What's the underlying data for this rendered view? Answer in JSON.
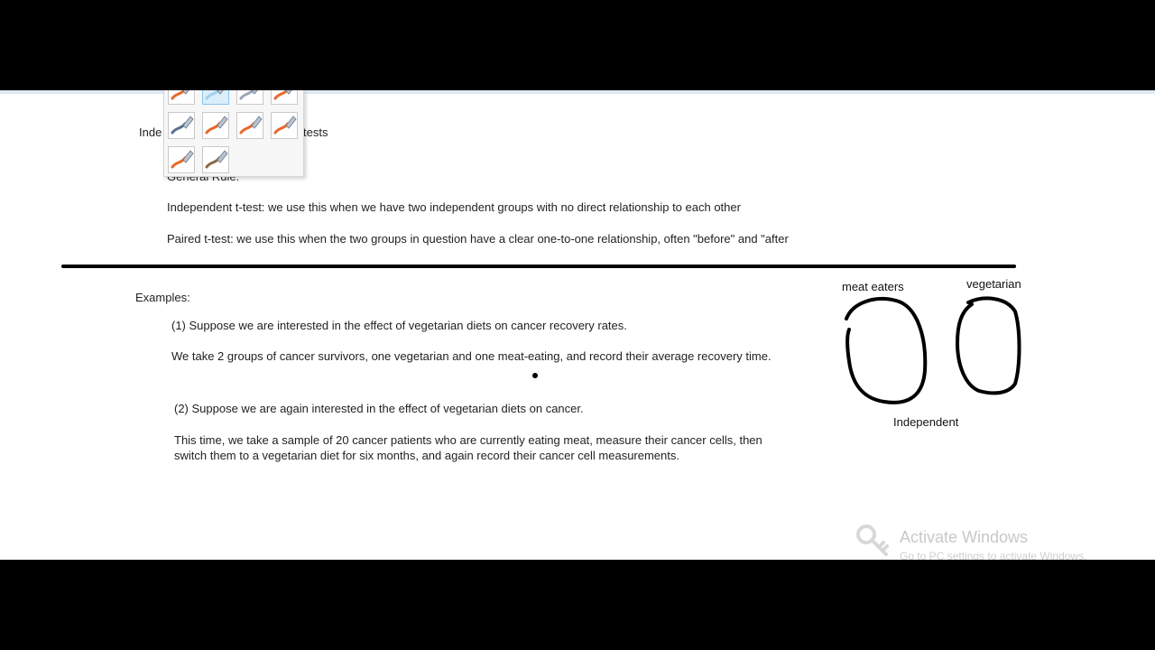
{
  "document": {
    "title_left": "Inde",
    "title_right": "tests",
    "general_rule": "General Rule:",
    "independent_rule": "Independent t-test: we use this when we have two independent groups with no direct relationship to each other",
    "paired_rule": "Paired t-test: we use this when the two groups in question have a clear one-to-one relationship, often \"before\" and \"after",
    "examples_heading": "Examples:",
    "example1_line1": "(1) Suppose we are interested in the effect of vegetarian diets on cancer recovery rates.",
    "example1_line2": "We take 2 groups of cancer survivors, one vegetarian and one meat-eating, and record their average recovery time.",
    "example2_line1": "(2) Suppose we are again interested in the effect of vegetarian diets on cancer.",
    "example2_line2a": "This time, we take a sample of 20 cancer patients who are currently eating meat, measure their cancer cells, then",
    "example2_line2b": "switch them to a vegetarian diet for six months, and again record their cancer cell measurements."
  },
  "annotation": {
    "label_left": "meat eaters",
    "label_right": "vegetarian",
    "caption": "Independent"
  },
  "pen_gallery": {
    "pens": [
      {
        "name": "pen-1",
        "color": "#e8672a",
        "selected": false
      },
      {
        "name": "pen-2",
        "color": "#9fd0f0",
        "selected": true
      },
      {
        "name": "pen-3",
        "color": "#9aa6b2",
        "selected": false
      },
      {
        "name": "pen-4",
        "color": "#e8672a",
        "selected": false
      },
      {
        "name": "pen-5",
        "color": "#5b6f8f",
        "selected": false
      },
      {
        "name": "pen-6",
        "color": "#e8672a",
        "selected": false
      },
      {
        "name": "pen-7",
        "color": "#e8672a",
        "selected": false
      },
      {
        "name": "pen-8",
        "color": "#e8672a",
        "selected": false
      },
      {
        "name": "pen-9",
        "color": "#e8672a",
        "selected": false
      },
      {
        "name": "pen-10",
        "color": "#8a6a4a",
        "selected": false
      }
    ]
  },
  "watermark": {
    "title": "Activate Windows",
    "subtitle": "Go to PC settings to activate Windows."
  },
  "colors": {
    "page": "#ffffff",
    "letterbox": "#000000",
    "ink": "#000000",
    "pen_accent": "#e8672a"
  }
}
